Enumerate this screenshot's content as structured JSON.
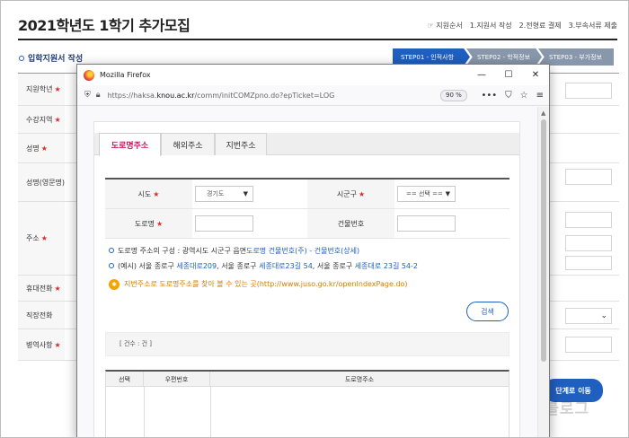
{
  "page": {
    "title": "2021학년도 1학기 추가모집",
    "steps_nav": [
      "☞ 지원순서",
      "1.지원서 작성",
      "2.전형료 결제",
      "3.부속서류 제출"
    ],
    "section_title": "입학지원서 작성",
    "step_tabs": [
      "STEP01 - 인적사항",
      "STEP02 - 학적정보",
      "STEP03 - 부가정보"
    ],
    "form_labels": [
      {
        "text": "지원학년",
        "required": true
      },
      {
        "text": "수강지역",
        "required": true
      },
      {
        "text": "성명",
        "required": true
      },
      {
        "text": "성명(영문명)",
        "required": false
      },
      {
        "text": "주소",
        "required": true
      },
      {
        "text": "휴대전화",
        "required": true
      },
      {
        "text": "직장전화",
        "required": false
      },
      {
        "text": "병역사항",
        "required": true
      }
    ],
    "required_mark": "★",
    "next_button": "단계로 이동",
    "watermark": "갱쥬블로그"
  },
  "browser": {
    "window_title": "Mozilla Firefox",
    "url_prefix": "https://haksa.",
    "url_host": "knou.ac.kr",
    "url_path": "/comm/initCOMZpno.do?epTicket=LOG",
    "zoom": "90 %",
    "controls": {
      "minimize": "—",
      "maximize": "☐",
      "close": "✕"
    },
    "actions": {
      "more": "•••",
      "pocket": "⛉",
      "bookmark": "☆",
      "menu": "≡"
    }
  },
  "address_search": {
    "tabs": [
      "도로명주소",
      "해외주소",
      "지번주소"
    ],
    "active_tab": 0,
    "fields": {
      "sido_label": "시도",
      "sido_value": "경기도",
      "sigungu_label": "시군구",
      "sigungu_value": "== 선택 ==",
      "road_label": "도로명",
      "building_label": "건물번호"
    },
    "note1_prefix": "도로명 주소의 구성 : 광역시도 시군구 읍면",
    "note1_highlight": "도로명 건물번호(주) - 건물번호(상세)",
    "note2_a": "(예시) 서울 종로구 ",
    "note2_b": "세종대로209",
    "note2_c": ", 서울 종로구 ",
    "note2_d": "세종대로23길 54",
    "note2_e": ", 서울 종로구 ",
    "note2_f": "세종대로 23길 54-2",
    "tip_icon": "✱",
    "tip_text": "지번주소로 도로명주소를 찾아 볼 수 있는 곳(http://www.juso.go.kr/openIndexPage.do)",
    "search_button": "검색",
    "count_text": "[ 건수 : 건 ]",
    "result_columns": [
      "선택",
      "우편번호",
      "도로명주소"
    ]
  }
}
